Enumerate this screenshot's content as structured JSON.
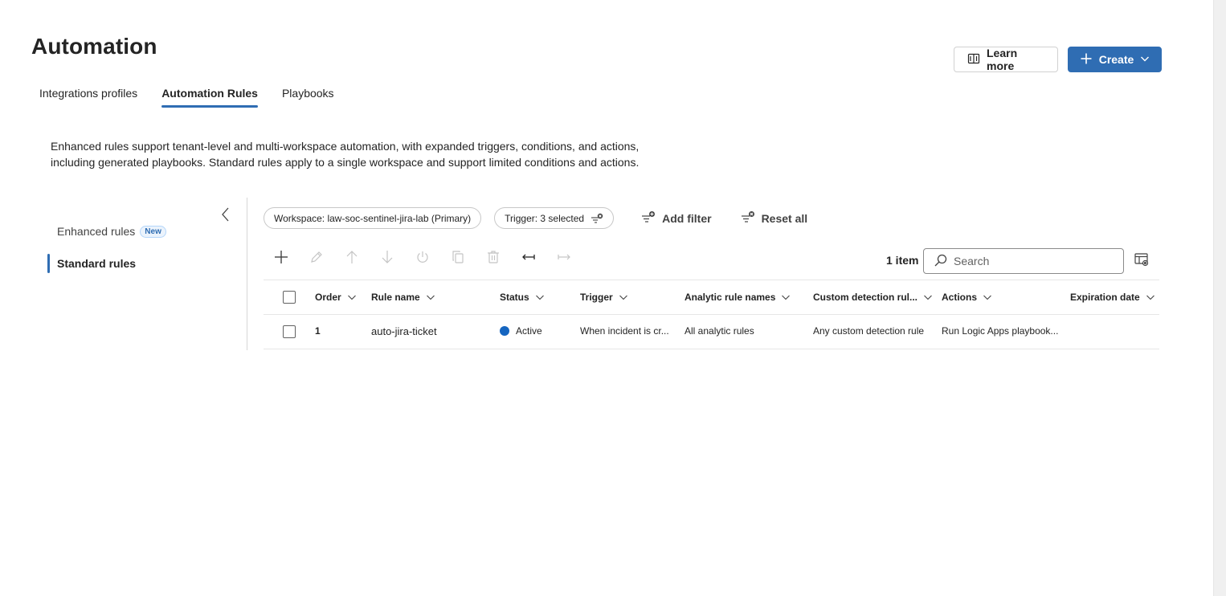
{
  "page": {
    "title": "Automation"
  },
  "header": {
    "learn_more_label": "Learn more",
    "create_label": "Create"
  },
  "tabs": [
    {
      "label": "Integrations profiles"
    },
    {
      "label": "Automation Rules",
      "active": true
    },
    {
      "label": "Playbooks"
    }
  ],
  "description": {
    "line1": "Enhanced rules support tenant-level and multi-workspace automation, with expanded triggers, conditions, and actions,",
    "line2": "including generated playbooks. Standard rules apply to a single workspace and support limited conditions and actions."
  },
  "side_nav": {
    "items": [
      {
        "label": "Enhanced rules",
        "badge": "New"
      },
      {
        "label": "Standard rules",
        "active": true
      }
    ]
  },
  "filters": {
    "workspace_pill": "Workspace: law-soc-sentinel-jira-lab (Primary)",
    "trigger_pill": "Trigger: 3 selected",
    "add_filter_label": "Add filter",
    "reset_all_label": "Reset all"
  },
  "toolbar": {
    "icons": [
      "add-icon",
      "edit-icon",
      "move-up-icon",
      "move-down-icon",
      "power-icon",
      "copy-icon",
      "delete-icon",
      "collapse-columns-icon",
      "expand-columns-icon"
    ],
    "count_label": "1 item"
  },
  "search": {
    "placeholder": "Search"
  },
  "table": {
    "columns": [
      "Order",
      "Rule name",
      "Status",
      "Trigger",
      "Analytic rule names",
      "Custom detection rul...",
      "Actions",
      "Expiration date"
    ],
    "rows": [
      {
        "order": "1",
        "rule_name": "auto-jira-ticket",
        "status": "Active",
        "trigger": "When incident is cr...",
        "analytic_rule_names": "All analytic rules",
        "custom_detection_rule": "Any custom detection rule",
        "actions": "Run Logic Apps playbook...",
        "expiration_date": ""
      }
    ]
  },
  "colors": {
    "accent": "#2f6db3",
    "status_active": "#1565c0"
  }
}
